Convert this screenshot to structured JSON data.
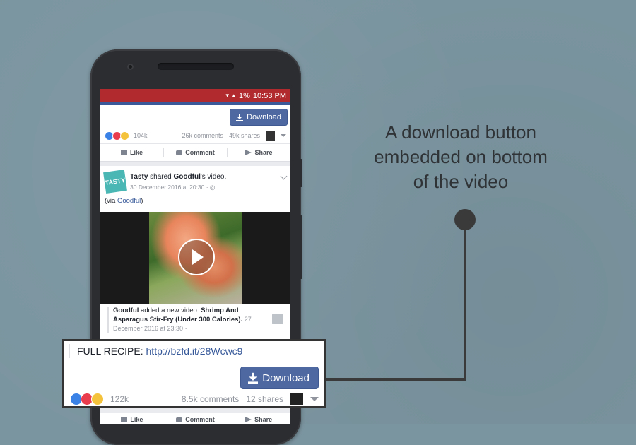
{
  "status_bar": {
    "signal": "▾ ▴",
    "battery": "1%",
    "time": "10:53 PM"
  },
  "top_post": {
    "download_label": "Download",
    "reactions": "104k",
    "comments": "26k comments",
    "shares": "49k shares"
  },
  "actions": {
    "like": "Like",
    "comment": "Comment",
    "share": "Share"
  },
  "post": {
    "page": "Tasty",
    "shared_text": " shared ",
    "source": "Goodful",
    "suffix": "'s video.",
    "timestamp": "30 December 2016 at 20:30 · ",
    "via_prefix": "(via ",
    "via_link": "Goodful",
    "via_suffix": ")",
    "logo_text": "TASTY"
  },
  "shared_video": {
    "author": "Goodful",
    "action": " added a new video: ",
    "title": "Shrimp And Asparagus Stir-Fry (Under 300 Calories).",
    "date": " 27 December 2016 at 23:30 · "
  },
  "zoom": {
    "recipe_label": "FULL RECIPE: ",
    "recipe_url": "http://bzfd.it/28Wcwc9",
    "download_label": "Download",
    "reactions": "122k",
    "comments": "8.5k comments",
    "shares": "12 shares"
  },
  "annotation": {
    "line1": "A download button",
    "line2": "embedded on bottom",
    "line3": "of the video"
  },
  "colors": {
    "background": "#7b95a0",
    "status_bar": "#b12a2e",
    "fb_blue": "#4e69a2",
    "link": "#365899"
  }
}
